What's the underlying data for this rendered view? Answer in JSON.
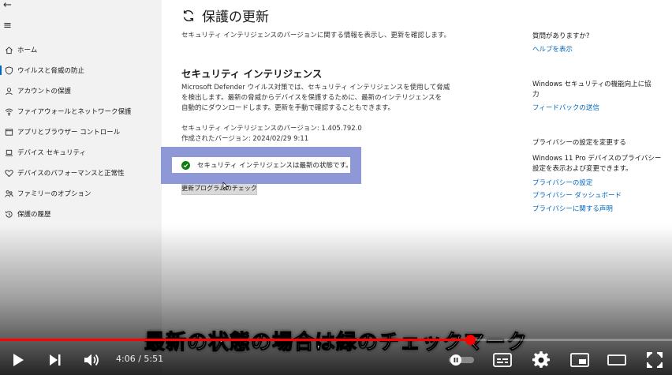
{
  "sidebar": {
    "back_glyph": "←",
    "menu_glyph": "≡",
    "items": [
      {
        "label": "ホーム",
        "icon": "home-icon"
      },
      {
        "label": "ウイルスと脅威の防止",
        "icon": "shield-icon"
      },
      {
        "label": "アカウントの保護",
        "icon": "person-icon"
      },
      {
        "label": "ファイアウォールとネットワーク保護",
        "icon": "wifi-icon"
      },
      {
        "label": "アプリとブラウザー コントロール",
        "icon": "app-window-icon"
      },
      {
        "label": "デバイス セキュリティ",
        "icon": "laptop-icon"
      },
      {
        "label": "デバイスのパフォーマンスと正常性",
        "icon": "heart-icon"
      },
      {
        "label": "ファミリーのオプション",
        "icon": "family-icon"
      },
      {
        "label": "保護の履歴",
        "icon": "history-icon"
      }
    ]
  },
  "main": {
    "title": "保護の更新",
    "subtitle": "セキュリティ インテリジェンスのバージョンに関する情報を表示し、更新を確認します。",
    "section_title": "セキュリティ インテリジェンス",
    "description": [
      "Microsoft Defender ウイルス対策では、セキュリティ インテリジェンスを使用して脅威",
      "を検出します。最新の脅威からデバイスを保護するために、最新のインテリジェンスを",
      "自動的にダウンロードします。更新を手動で確認することもできます。"
    ],
    "version_line": "セキュリティ インテリジェンスのバージョン: 1.405.792.0",
    "created_line": "作成されたバージョン: 2024/02/29 9:11",
    "status_message": "セキュリティ インテリジェンスは最新の状態です。",
    "check_button": "更新プログラムのチェック"
  },
  "right": {
    "question_heading": "質問がありますか?",
    "help_link": "ヘルプを表示",
    "improve_heading": [
      "Windows セキュリティの機能向上に協",
      "力"
    ],
    "feedback_link": "フィードバックの送信",
    "privacy_heading": "プライバシーの設定を変更する",
    "privacy_desc": [
      "Windows 11 Pro デバイスのプライバシー",
      "設定を表示および変更できます。"
    ],
    "privacy_links": [
      "プライバシーの設定",
      "プライバシー ダッシュボード",
      "プライバシーに関する声明"
    ]
  },
  "player": {
    "subtitle": "最新の状態の場合は緑のチェックマーク",
    "time": "4:06 / 5:51",
    "progress": 0.7
  },
  "colors": {
    "accent": "#0067c0",
    "highlight": "#8f98d6",
    "check_green": "#107c10",
    "progress_red": "#ff0000"
  }
}
